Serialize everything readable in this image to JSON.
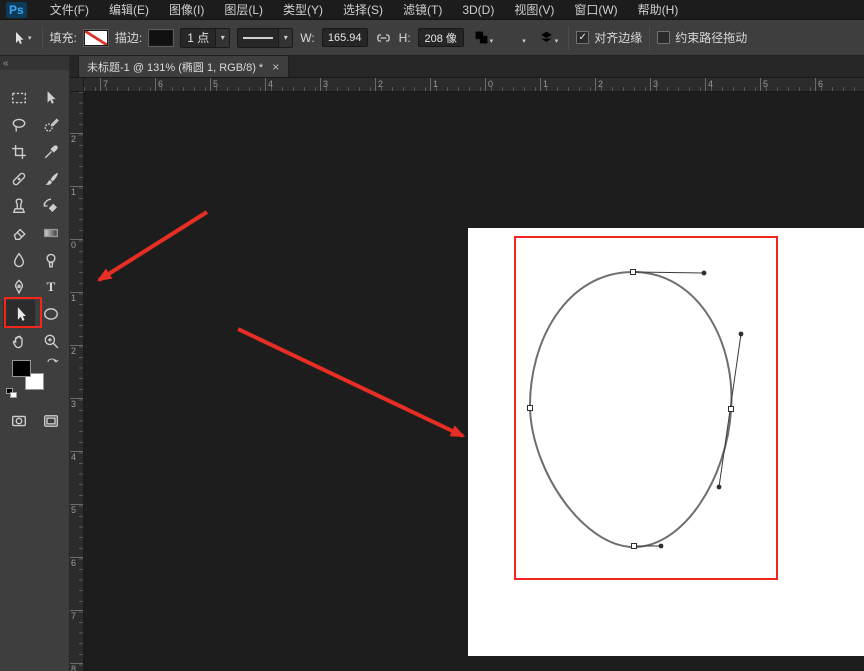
{
  "app": {
    "logo": "Ps",
    "menus": [
      "文件(F)",
      "编辑(E)",
      "图像(I)",
      "图层(L)",
      "类型(Y)",
      "选择(S)",
      "滤镜(T)",
      "3D(D)",
      "视图(V)",
      "窗口(W)",
      "帮助(H)"
    ]
  },
  "options": {
    "fill_label": "填充:",
    "stroke_label": "描边:",
    "stroke_width_value": "1 点",
    "w_label": "W:",
    "w_value": "165.94",
    "h_label": "H:",
    "h_value": "208 像",
    "align_edges": {
      "label": "对齐边缘",
      "checked": true
    },
    "constrain_drag": {
      "label": "约束路径拖动",
      "checked": false
    }
  },
  "document_tab": {
    "title": "未标题-1 @ 131% (椭圆 1, RGB/8) *",
    "close": "×"
  },
  "toolbar": {
    "tools": [
      "rectangular-marquee",
      "move",
      "lasso",
      "quick-selection",
      "crop",
      "eyedropper",
      "spot-healing-brush",
      "brush",
      "clone-stamp",
      "history-brush",
      "eraser",
      "gradient",
      "blur",
      "dodge",
      "pen",
      "type",
      "path-selection",
      "ellipse-shape",
      "hand",
      "zoom"
    ],
    "active_tool": "path-selection",
    "type_glyph": "T"
  },
  "rulers": {
    "horizontal": [
      "7",
      "6",
      "5",
      "4",
      "3",
      "2",
      "1",
      "0",
      "1",
      "2",
      "3",
      "4",
      "5",
      "6"
    ],
    "vertical": [
      "2",
      "1",
      "0",
      "1",
      "2",
      "3",
      "4",
      "5",
      "6",
      "7",
      "8"
    ]
  },
  "icons": {
    "collapse": "«",
    "dropdown": "▾",
    "check": "✓"
  },
  "colors": {
    "annotation_red": "#e62e24",
    "panel_gray": "#3e3e3e",
    "canvas_dark": "#1d1d1d"
  }
}
